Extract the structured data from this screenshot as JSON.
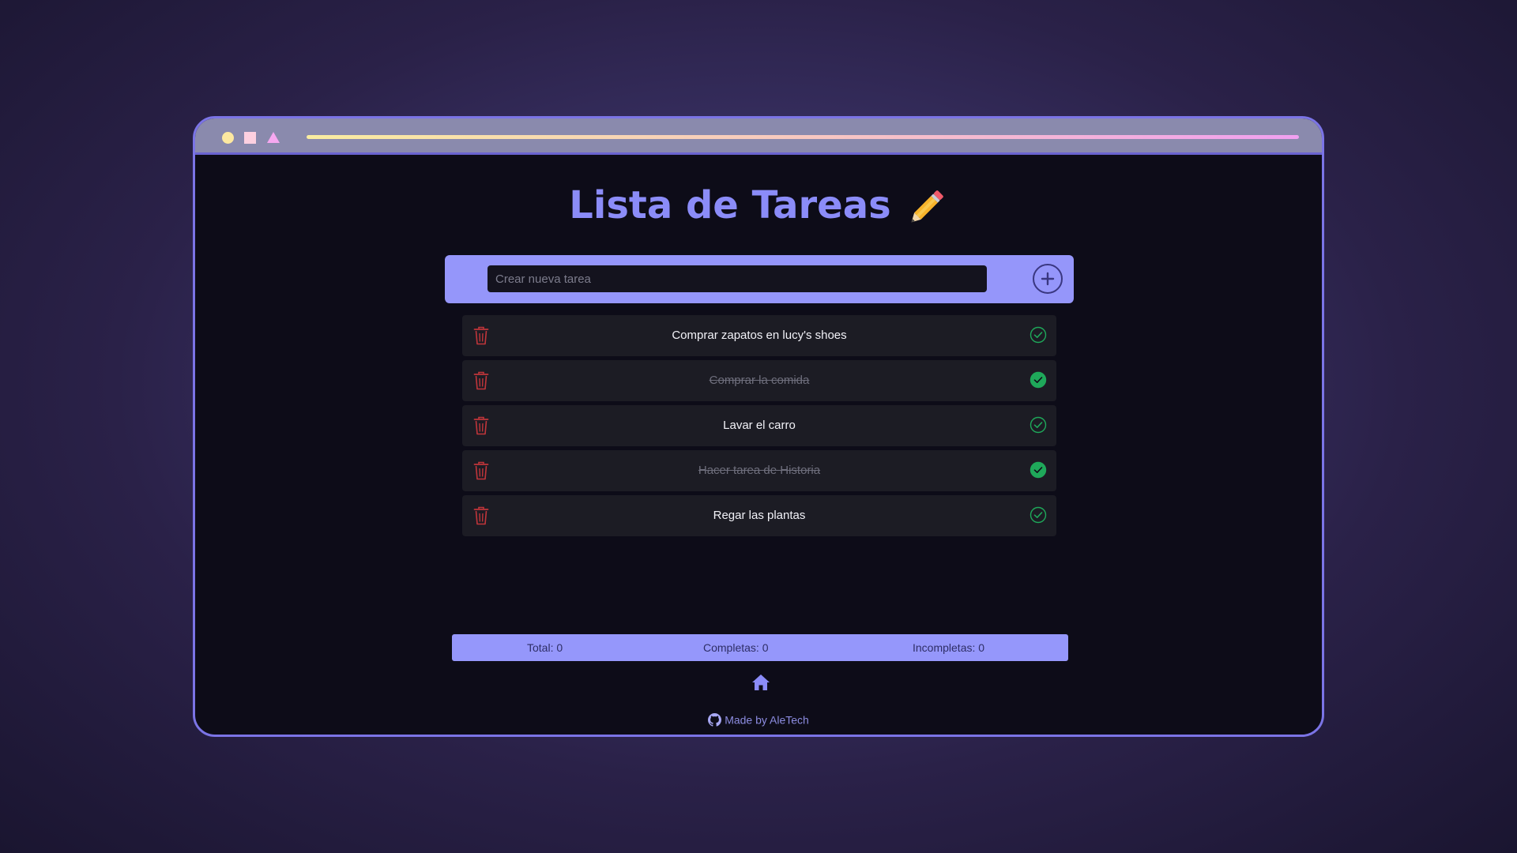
{
  "colors": {
    "accent": "#9596fa",
    "title": "#8b8cf8",
    "delete": "#c0353a",
    "check": "#1fa85a",
    "window_bg": "#0d0c18",
    "row_bg": "#1c1c24"
  },
  "header": {
    "title": "Lista de Tareas",
    "title_icon": "pencil-icon"
  },
  "input": {
    "placeholder": "Crear nueva tarea",
    "value": "",
    "add_icon": "plus-circle-icon"
  },
  "tasks": [
    {
      "text": "Comprar zapatos en lucy's shoes",
      "completed": false
    },
    {
      "text": "Comprar la comida",
      "completed": true
    },
    {
      "text": "Lavar el carro",
      "completed": false
    },
    {
      "text": "Hacer tarea de Historia",
      "completed": true
    },
    {
      "text": "Regar las plantas",
      "completed": false
    }
  ],
  "stats": {
    "total": "Total: 0",
    "completas": "Completas: 0",
    "incompletas": "Incompletas: 0"
  },
  "nav": {
    "home_icon": "home-icon"
  },
  "footer": {
    "text": "Made by AleTech",
    "icon": "github-icon"
  }
}
